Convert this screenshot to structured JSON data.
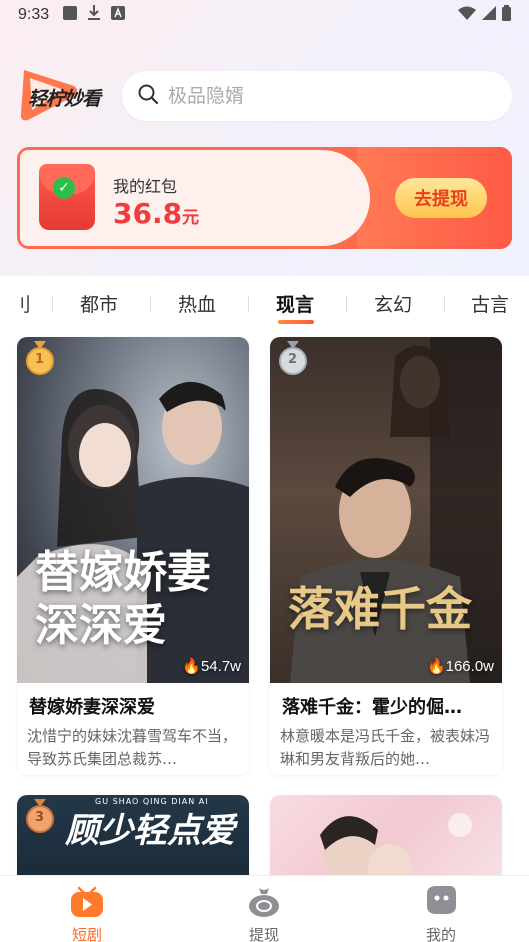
{
  "status_bar": {
    "time": "9:33"
  },
  "header": {
    "logo_text": "轻柠妙看",
    "search_placeholder": "极品隐婿"
  },
  "red_packet": {
    "title": "我的红包",
    "amount": "36.8",
    "unit": "元",
    "button_label": "去提现"
  },
  "tabs": [
    {
      "label": "刂"
    },
    {
      "label": "都市"
    },
    {
      "label": "热血"
    },
    {
      "label": "现言",
      "active": true
    },
    {
      "label": "玄幻"
    },
    {
      "label": "古言"
    }
  ],
  "cards": [
    {
      "rank": "1",
      "poster_text_line1": "替嫁娇妻",
      "poster_text_line2": "深深爱",
      "hot": "54.7w",
      "title": "替嫁娇妻深深爱",
      "desc": "沈惜宁的妹妹沈暮雪驾车不当，导致苏氏集团总裁苏…"
    },
    {
      "rank": "2",
      "poster_text_line1": "落难",
      "poster_text_line2": "千金",
      "hot": "166.0w",
      "title": "落难千金：霍少的倔…",
      "desc": "林意暖本是冯氏千金，被表妹冯琳和男友背叛后的她…"
    },
    {
      "rank": "3",
      "poster_text_line1": "顾少轻点爱",
      "poster_subtext": "GU SHAO QING DIAN AI"
    },
    {
      "rank": ""
    }
  ],
  "bottom_nav": [
    {
      "label": "短剧",
      "active": true
    },
    {
      "label": "提现"
    },
    {
      "label": "我的"
    }
  ]
}
